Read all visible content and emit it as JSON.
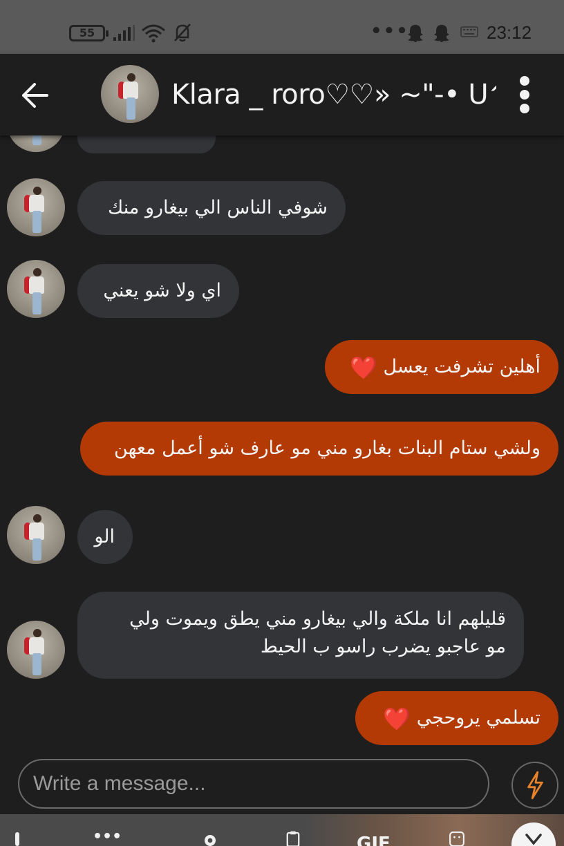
{
  "status_bar": {
    "battery": "55",
    "time": "23:12",
    "overflow": "•••"
  },
  "header": {
    "back_icon": "arrow-left-icon",
    "title": "Klara _ roro♡♡» ~\"-• U^...",
    "menu_icon": "more-vertical-icon"
  },
  "messages": [
    {
      "from": "them",
      "text": ""
    },
    {
      "from": "them",
      "text": "شوفي الناس الي بيغارو منك"
    },
    {
      "from": "them",
      "text": "اي ولا شو يعني"
    },
    {
      "from": "me",
      "text": "أهلين تشرفت يعسل",
      "emoji": "❤️"
    },
    {
      "from": "me",
      "text": "ولشي ستام البنات بغارو مني مو عارف شو أعمل معهن"
    },
    {
      "from": "them",
      "text": "الو"
    },
    {
      "from": "them",
      "lines": [
        "قليلهم انا ملكة والي بيغارو مني يطق ويموت ولي",
        "مو عاجبو يضرب راسو ب الحيط"
      ]
    },
    {
      "from": "me",
      "text": "تسلمي يروحجي",
      "emoji": "❤️"
    }
  ],
  "composer": {
    "placeholder": "Write a message...",
    "send_icon": "lightning-icon"
  },
  "keyboard": {
    "gif_label": "GIF"
  },
  "colors": {
    "background": "#1e1e1e",
    "incoming_bubble": "#333438",
    "outgoing_bubble": "#b33a05",
    "accent": "#e8832a"
  }
}
